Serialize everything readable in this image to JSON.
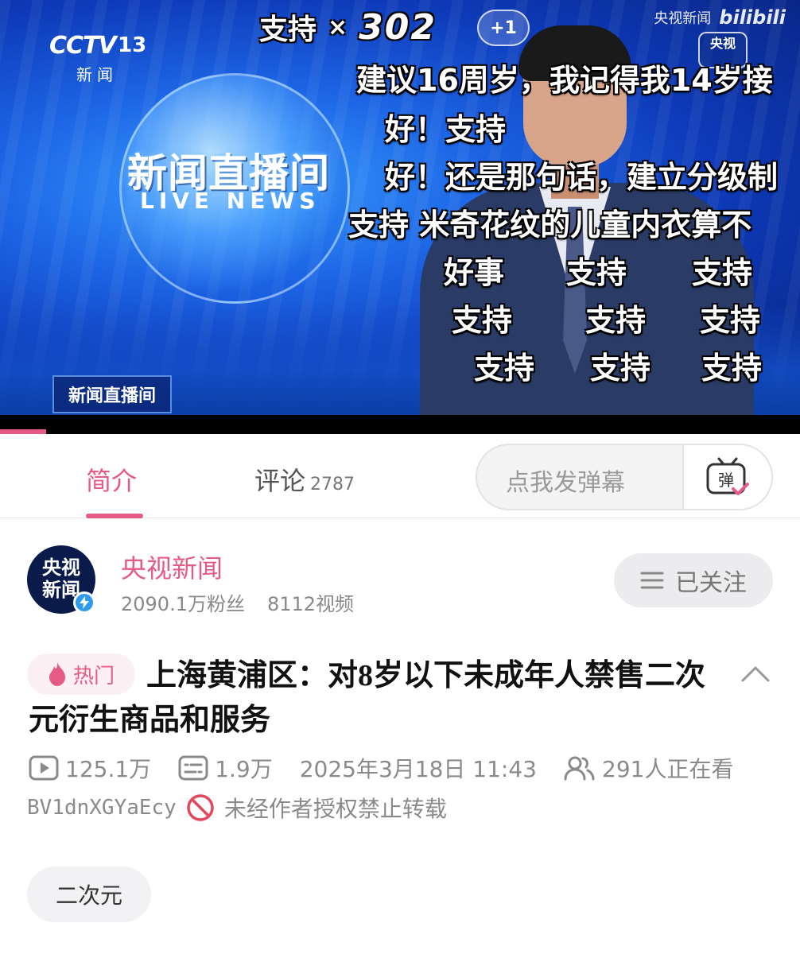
{
  "video": {
    "channel_logo": "CCTV",
    "channel_number": "13",
    "channel_sub": "新闻",
    "show_title": "新闻直播间",
    "show_subtitle": "LIVE NEWS",
    "corner_badge": "新闻直播间",
    "combo": {
      "label": "支持",
      "times": "×",
      "count": "302"
    },
    "plus_badge": "+1",
    "watermark_source": "央视新闻",
    "watermark_brand": "bilibili",
    "corner_logo_line1": "央视",
    "danmaku": [
      "建议16周岁，我记得我14岁接",
      "好！支持",
      "好！还是那句话，建立分级制",
      "支持 米奇花纹的儿童内衣算不",
      "好事",
      "支持",
      "支持",
      "支持",
      "支持",
      "支持",
      "支持",
      "支持",
      "支持"
    ],
    "progress": 0.058
  },
  "tabs": {
    "intro_label": "简介",
    "comments_label": "评论",
    "comments_count": "2787",
    "danmaku_placeholder": "点我发弹幕",
    "danmaku_send_icon_text": "弹"
  },
  "uploader": {
    "avatar_text": "央视新闻",
    "name": "央视新闻",
    "followers": "2090.1万粉丝",
    "videos": "8112视频",
    "follow_label": "已关注"
  },
  "video_info": {
    "hot_label": "热门",
    "title": "上海黄浦区：对8岁以下未成年人禁售二次元衍生商品和服务",
    "views": "125.1万",
    "danmaku_count": "1.9万",
    "published": "2025年3月18日 11:43",
    "watching": "291人正在看",
    "bvid": "BV1dnXGYaEcy",
    "copyright": "未经作者授权禁止转载"
  },
  "tags": [
    "二次元"
  ],
  "colors": {
    "accent": "#e65a86",
    "muted": "#8a8a8a"
  }
}
